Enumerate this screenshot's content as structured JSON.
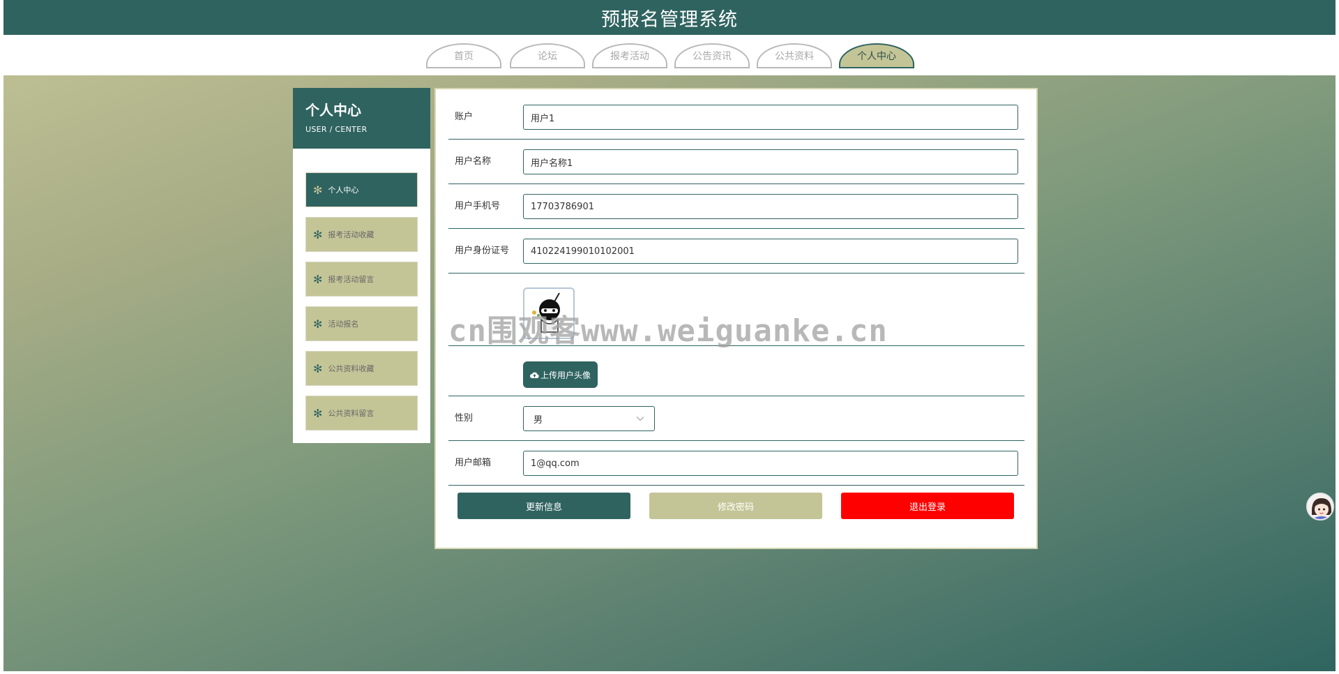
{
  "header": {
    "title": "预报名管理系统"
  },
  "nav": {
    "tabs": [
      {
        "label": "首页"
      },
      {
        "label": "论坛"
      },
      {
        "label": "报考活动"
      },
      {
        "label": "公告资讯"
      },
      {
        "label": "公共资料"
      },
      {
        "label": "个人中心"
      }
    ],
    "active": "个人中心"
  },
  "sidebar": {
    "title": "个人中心",
    "subtitle": "USER / CENTER",
    "items": [
      {
        "label": "个人中心"
      },
      {
        "label": "报考活动收藏"
      },
      {
        "label": "报考活动留言"
      },
      {
        "label": "活动报名"
      },
      {
        "label": "公共资料收藏"
      },
      {
        "label": "公共资料留言"
      }
    ]
  },
  "form": {
    "account": {
      "label": "账户",
      "value": "用户1"
    },
    "username": {
      "label": "用户名称",
      "value": "用户名称1"
    },
    "phone": {
      "label": "用户手机号",
      "value": "17703786901"
    },
    "idcard": {
      "label": "用户身份证号",
      "value": "410224199010102001"
    },
    "upload_label": "上传用户头像",
    "gender": {
      "label": "性别",
      "value": "男"
    },
    "email": {
      "label": "用户邮箱",
      "value": "1@qq.com"
    }
  },
  "actions": {
    "update": "更新信息",
    "password": "修改密码",
    "logout": "退出登录"
  },
  "watermark": "cn围观客www.weiguanke.cn",
  "colors": {
    "primary": "#2f6360",
    "accent": "#c4c597",
    "danger": "#ff0000"
  }
}
